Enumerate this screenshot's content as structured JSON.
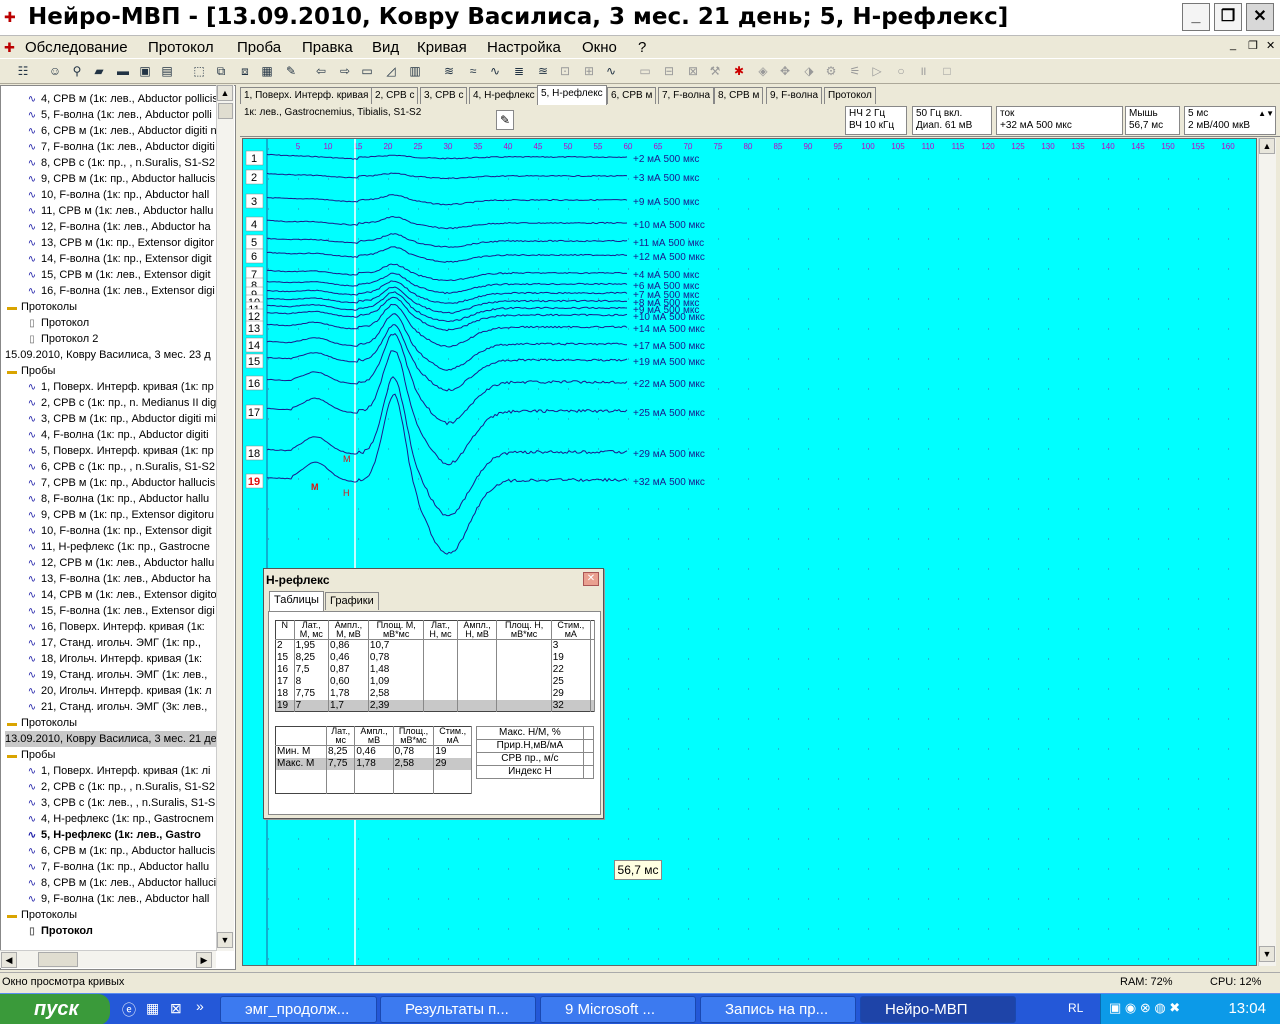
{
  "window": {
    "title": "Нейро-МВП - [13.09.2010, Ковру Василиса,  3 мес. 21 день; 5, Н-рефлекс]"
  },
  "menu": [
    "Обследование",
    "Протокол",
    "Проба",
    "Правка",
    "Вид",
    "Кривая",
    "Настройка",
    "Окно",
    "?"
  ],
  "tree": {
    "items_top": [
      "4, СРВ м (1к: лев., Abductor pollicis",
      "5, F-волна (1к: лев., Abductor polli",
      "6, СРВ м (1к: лев., Abductor digiti n",
      "7, F-волна (1к: лев., Abductor digiti",
      "8, СРВ с (1к: пр., , n.Suralis, S1-S2",
      "9, СРВ м (1к: пр., Abductor hallucis",
      "10, F-волна (1к: пр., Abductor hall",
      "11, СРВ м (1к: лев., Abductor hallu",
      "12, F-волна (1к: лев., Abductor ha",
      "13, СРВ м (1к: пр., Extensor digitor",
      "14, F-волна (1к: пр., Extensor digit",
      "15, СРВ м (1к: лев., Extensor digit",
      "16, F-волна (1к: лев., Extensor digi"
    ],
    "protocols1_label": "Протоколы",
    "protocols1": [
      "Протокол",
      "Протокол 2"
    ],
    "date2": "15.09.2010, Ковру Василиса,  3 мес. 23 д",
    "probes2_label": "Пробы",
    "items_mid": [
      "1, Поверх. Интерф. кривая (1к: пр",
      "2, СРВ с (1к: пр., n. Medianus II dig",
      "3, СРВ м (1к: пр., Abductor digiti mi",
      "4, F-волна (1к: пр., Abductor digiti",
      "5, Поверх. Интерф. кривая (1к: пр",
      "6, СРВ с (1к: пр., , n.Suralis, S1-S2",
      "7, СРВ м (1к: пр., Abductor hallucis",
      "8, F-волна (1к: пр., Abductor hallu",
      "9, СРВ м (1к: пр., Extensor digitoru",
      "10, F-волна (1к: пр., Extensor digit",
      "11, Н-рефлекс (1к: пр., Gastrocne",
      "12, СРВ м (1к: лев., Abductor hallu",
      "13, F-волна (1к: лев., Abductor ha",
      "14, СРВ м (1к: лев., Extensor digito",
      "15, F-волна (1к: лев., Extensor digi",
      "16, Поверх. Интерф. кривая (1к: ",
      "17, Станд. игольч. ЭМГ (1к: пр., ",
      "18, Игольч. Интерф. кривая (1к: ",
      "19, Станд. игольч. ЭМГ (1к: лев., ",
      "20, Игольч. Интерф. кривая (1к: л",
      "21, Станд. игольч. ЭМГ (3к: лев., "
    ],
    "protocols2_label": "Протоколы",
    "date3": "13.09.2010, Ковру Василиса,  3 мес. 21 де",
    "probes3_label": "Пробы",
    "items_bot": [
      "1, Поверх. Интерф. кривая (1к: лі",
      "2, СРВ с (1к: пр., , n.Suralis, S1-S2",
      "3, СРВ с (1к: лев., , n.Suralis, S1-S",
      "4, Н-рефлекс (1к: пр., Gastrocnem",
      "5, Н-рефлекс (1к: лев., Gastro",
      "6, СРВ м (1к: пр., Abductor hallucis",
      "7, F-волна (1к: пр., Abductor hallu",
      "8, СРВ м (1к: лев., Abductor halluci",
      "9, F-волна (1к: лев., Abductor hall"
    ],
    "protocols3_label": "Протоколы",
    "protocol3": "Протокол"
  },
  "tabs": [
    "1, Поверх. Интерф. кривая",
    "2, СРВ с",
    "3, СРВ с",
    "4, Н-рефлекс",
    "5, Н-рефлекс",
    "6, СРВ м",
    "7, F-волна",
    "8, СРВ м",
    "9, F-волна",
    "Протокол"
  ],
  "info": {
    "channel": "1к: лев., Gastrocnemius, Tibialis, S1-S2",
    "filter_lo": "НЧ  2 Гц",
    "filter_hi": "ВЧ  10 кГц",
    "notch": "50 Гц  вкл.",
    "range": "Диап. 61 мВ",
    "stim_label": "ток",
    "stim_value": "+32 мА 500 мкс",
    "mouse_label": "Мышь",
    "mouse_value": "56,7 мс",
    "sweep": "5 мс",
    "sens": "2 мВ/400 мкВ"
  },
  "plot": {
    "x_ticks": [
      5,
      10,
      15,
      20,
      25,
      30,
      35,
      40,
      45,
      50,
      55,
      60,
      65,
      70,
      75,
      80,
      85,
      90,
      95,
      100,
      105,
      110,
      115,
      120,
      125,
      130,
      135,
      140,
      145,
      150,
      155,
      160
    ],
    "traces": [
      {
        "n": "1",
        "label": "+2 мА 500 мкс"
      },
      {
        "n": "2",
        "label": "+3 мА 500 мкс"
      },
      {
        "n": "3",
        "label": "+9 мА 500 мкс"
      },
      {
        "n": "4",
        "label": "+10 мА 500 мкс"
      },
      {
        "n": "5",
        "label": "+11 мА 500 мкс"
      },
      {
        "n": "6",
        "label": "+12 мА 500 мкс"
      },
      {
        "n": "7",
        "label": "+4 мА 500 мкс"
      },
      {
        "n": "8",
        "label": "+6 мА 500 мкс"
      },
      {
        "n": "9",
        "label": "+7 мА 500 мкс"
      },
      {
        "n": "10",
        "label": "+8 мА 500 мкс"
      },
      {
        "n": "11",
        "label": "+9 мА 500 мкс"
      },
      {
        "n": "12",
        "label": "+10 мА 500 мкс"
      },
      {
        "n": "13",
        "label": "+14 мА 500 мкс"
      },
      {
        "n": "14",
        "label": "+17 мА 500 мкс"
      },
      {
        "n": "15",
        "label": "+19 мА 500 мкс"
      },
      {
        "n": "16",
        "label": "+22 мА 500 мкс"
      },
      {
        "n": "17",
        "label": "+25 мА 500 мкс"
      },
      {
        "n": "18",
        "label": "+29 мА 500 мкс"
      },
      {
        "n": "19",
        "label": "+32 мА 500 мкс"
      }
    ],
    "marker_m": "M",
    "marker_h": "H",
    "cursor_ms": "56,7 мс",
    "colors": {
      "bg": "#00ffff",
      "trace": "#1a1a8c",
      "label": "#1a1a8c",
      "marker": "#e01010"
    }
  },
  "dialog": {
    "title": "Н-рефлекс",
    "tab_tables": "Таблицы",
    "tab_graphs": "Графики",
    "table1_headers": [
      "N",
      "Лат.,\nМ, мс",
      "Ампл.,\nМ, мВ",
      "Площ. М,\nмВ*мс",
      "Лат.,\nН, мс",
      "Ампл.,\nН, мВ",
      "Площ. Н,\nмВ*мс",
      "Стим.,\nмА",
      ""
    ],
    "table1_rows": [
      [
        "2",
        "1,95",
        "0,86",
        "10,7",
        "",
        "",
        "",
        "3",
        ""
      ],
      [
        "15",
        "8,25",
        "0,46",
        "0,78",
        "",
        "",
        "",
        "19",
        ""
      ],
      [
        "16",
        "7,5",
        "0,87",
        "1,48",
        "",
        "",
        "",
        "22",
        ""
      ],
      [
        "17",
        "8",
        "0,60",
        "1,09",
        "",
        "",
        "",
        "25",
        ""
      ],
      [
        "18",
        "7,75",
        "1,78",
        "2,58",
        "",
        "",
        "",
        "29",
        ""
      ],
      [
        "19",
        "7",
        "1,7",
        "2,39",
        "",
        "",
        "",
        "32",
        ""
      ]
    ],
    "table2_headers": [
      "",
      "Лат.,\nмс",
      "Ампл.,\nмВ",
      "Площ.,\nмВ*мс",
      "Стим.,\nмА"
    ],
    "table2_rows": [
      [
        "Мин. М",
        "8,25",
        "0,46",
        "0,78",
        "19"
      ],
      [
        "Макс. М",
        "7,75",
        "1,78",
        "2,58",
        "29"
      ],
      [
        "",
        "",
        "",
        "",
        ""
      ],
      [
        "",
        "",
        "",
        "",
        ""
      ]
    ],
    "table3_rows": [
      [
        "Макс. Н/М, %",
        ""
      ],
      [
        "Прир.Н,мВ/мА",
        ""
      ],
      [
        "СРВ пр., м/с",
        ""
      ],
      [
        "Индекс Н",
        ""
      ]
    ]
  },
  "status": {
    "left": "Окно просмотра кривых",
    "ram": "RAM: 72%",
    "cpu": "CPU: 12%"
  },
  "taskbar": {
    "start": "пуск",
    "tasks": [
      "эмг_продолж...",
      "Результаты п...",
      "9 Microsoft ...",
      "Запись на пр...",
      "Нейро-МВП"
    ],
    "lang": "RL",
    "clock": "13:04"
  }
}
